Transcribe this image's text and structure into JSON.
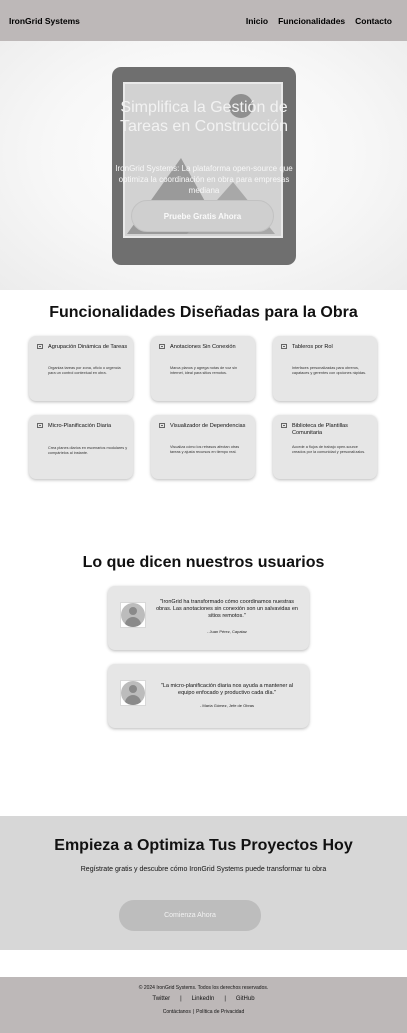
{
  "nav": {
    "brand": "IronGrid Systems",
    "links": [
      "Inicio",
      "Funcionalidades",
      "Contacto"
    ]
  },
  "hero": {
    "title": "Simplifica la Gestión de Tareas en Construcción",
    "subtitle": "IronGrid Systems: La plataforma open-source que optimiza la coordinación en obra para empresas mediana",
    "cta": "Pruebe Gratis Ahora"
  },
  "features": {
    "title": "Funcionalidades Diseñadas para la Obra",
    "items": [
      {
        "title": "Agrupación Dinámica de Tareas",
        "desc": "Organiza tareas por zona, oficio o urgencia para un control contextual en obra.",
        "icon": "image-icon"
      },
      {
        "title": "Anotaciones Sin Conexión",
        "desc": "Marca planos y agrega notas de voz sin internet, ideal para sitios remotos.",
        "icon": "image-icon"
      },
      {
        "title": "Tableros por Rol",
        "desc": "Interfaces personalizadas para obreros, capataces y gerentes con opciones rápidas.",
        "icon": "image-icon"
      },
      {
        "title": "Micro-Planificación Diaria",
        "desc": "Crea planes diarios en escenarios modulares y compártelos al instante.",
        "icon": "image-icon"
      },
      {
        "title": "Visualizador de Dependencias",
        "desc": "Visualiza cómo los retrasos afectan otras tareas y ajusta recursos en tiempo real.",
        "icon": "image-icon"
      },
      {
        "title": "Biblioteca de Plantillas Comunitaria",
        "desc": "Accede a flujos de trabajo open-source creados por la comunidad y personalízalos.",
        "icon": "image-icon"
      }
    ]
  },
  "testimonials": {
    "title": "Lo que dicen nuestros usuarios",
    "items": [
      {
        "quote": "\"IronGrid ha transformado cómo coordinamos nuestras obras. Las anotaciones sin conexión son un salvavidas en sitios remotos.\"",
        "author": "- Juan Pérez, Capataz"
      },
      {
        "quote": "\"La micro-planificación diaria nos ayuda a mantener al equipo enfocado y productivo cada día.\"",
        "author": "- María Gómez, Jefe de Obras"
      }
    ]
  },
  "cta": {
    "title": "Empieza a Optimiza Tus Proyectos Hoy",
    "subtitle": "Regístrate gratis y descubre cómo IronGrid Systems puede transformar tu obra",
    "button": "Comienza Ahora"
  },
  "footer": {
    "copyright": "© 2024 IronGrid Systems. Todos los derechos reservados.",
    "social": [
      "Twitter",
      "LinkedIn",
      "GitHub"
    ],
    "legal": [
      "Contáctanos",
      "Política de Privacidad"
    ],
    "separator": "|"
  },
  "colors": {
    "nav_bg": "#bdb8b8",
    "card_bg": "#e6e6e6",
    "cta_bg": "#d7d7d7"
  }
}
